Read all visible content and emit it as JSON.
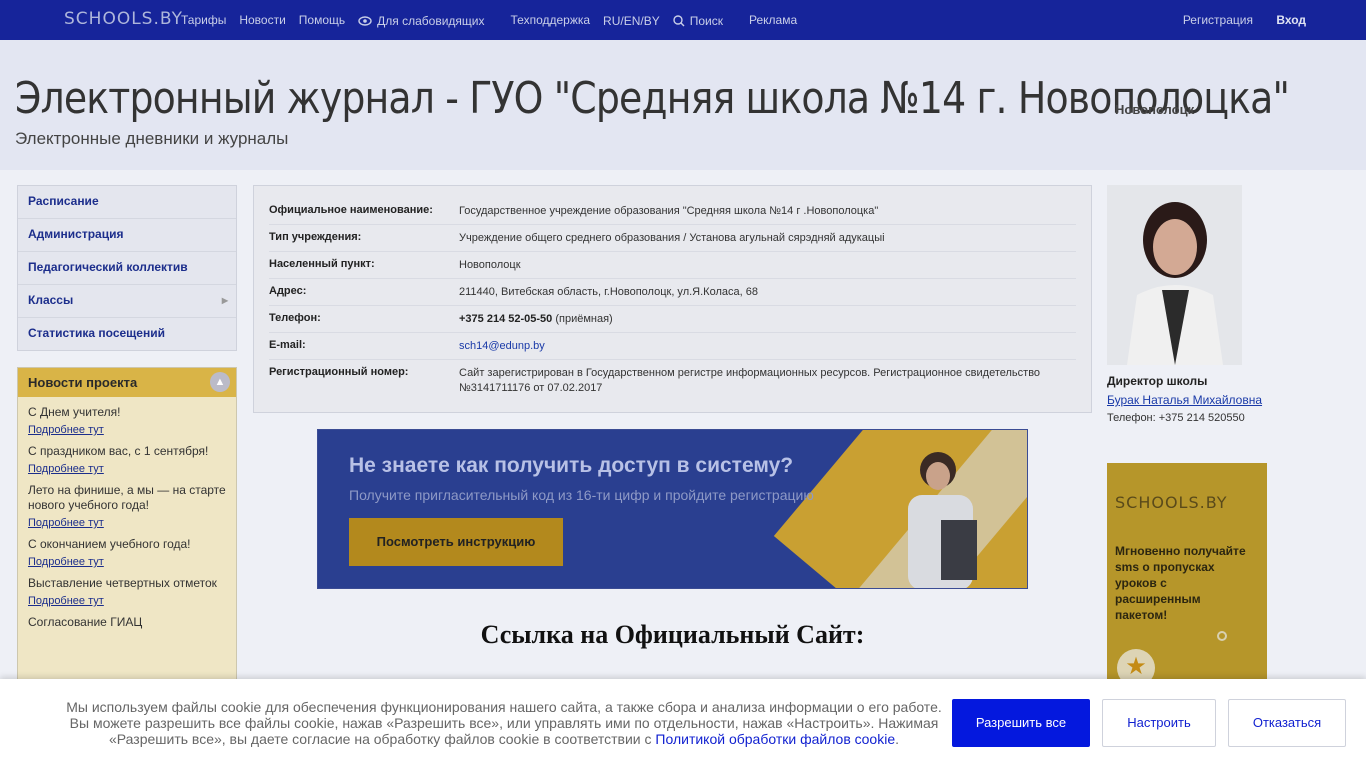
{
  "topbar": {
    "logo": "SCHOOLS.BY",
    "nav": [
      "Тарифы",
      "Новости",
      "Помощь",
      "Для слабовидящих",
      "Техподдержка",
      "RU/EN/BY",
      "Поиск",
      "Реклама"
    ],
    "register": "Регистрация",
    "login": "Вход"
  },
  "header": {
    "title": "Электронный журнал - ГУО \"Средняя школа №14 г. Новополоцка\"",
    "city": "Новополоцк",
    "subtitle": "Электронные дневники и журналы"
  },
  "sidebar": {
    "menu": [
      "Расписание",
      "Администрация",
      "Педагогический коллектив",
      "Классы",
      "Статистика посещений"
    ],
    "news_title": "Новости проекта",
    "news": [
      {
        "title": "С Днем учителя!",
        "more": "Подробнее тут"
      },
      {
        "title": "С праздником вас, с 1 сентября!",
        "more": "Подробнее тут"
      },
      {
        "title": "Лето на финише, а мы — на старте нового учебного года!",
        "more": "Подробнее тут"
      },
      {
        "title": "С окончанием учебного года!",
        "more": "Подробнее тут"
      },
      {
        "title": "Выставление четвертных отметок",
        "more": "Подробнее тут"
      },
      {
        "title": "Согласование ГИАЦ",
        "more": ""
      }
    ]
  },
  "info": {
    "rows": [
      {
        "label": "Официальное наименование:",
        "value": "Государственное учреждение образования \"Средняя школа №14 г .Новополоцка\""
      },
      {
        "label": "Тип учреждения:",
        "value": "Учреждение общего среднего образования / Установа агульнай сярэдняй адукацыі"
      },
      {
        "label": "Населенный пункт:",
        "value": "Новополоцк"
      },
      {
        "label": "Адрес:",
        "value": "211440, Витебская область, г.Новополоцк, ул.Я.Коласа, 68"
      },
      {
        "label": "Телефон:",
        "value_bold": "+375 214 52-05-50",
        "value": " (приёмная)"
      },
      {
        "label": "E-mail:",
        "link": "sch14@edunp.by"
      },
      {
        "label": "Регистрационный номер:",
        "value": "Сайт зарегистрирован в Государственном регистре информационных ресурсов. Регистрационное свидетельство №3141711176 от 07.02.2017"
      }
    ]
  },
  "banner": {
    "headline": "Не знаете как получить доступ в систему?",
    "subline": "Получите пригласительный код из 16-ти цифр и пройдите регистрацию",
    "button": "Посмотреть инструкцию"
  },
  "official_link_heading": "Ссылка на Официальный Сайт:",
  "director": {
    "role": "Директор школы",
    "name": "Бурак Наталья Михайловна",
    "phone": "Телефон: +375 214 520550"
  },
  "ad": {
    "logo": "SCHOOLS.BY",
    "text": "Мгновенно получайте sms о пропусках уроков с расширенным пакетом!"
  },
  "cookie": {
    "text": "Мы используем файлы cookie для обеспечения функционирования нашего сайта, а также сбора и анализа информации о его работе. Вы можете разрешить все файлы cookie, нажав «Разрешить все», или управлять ими по отдельности, нажав «Настроить». Нажимая «Разрешить все», вы даете согласие на обработку файлов cookie в соответствии с ",
    "policy_link": "Политикой обработки файлов cookie",
    "tail": ".",
    "allow": "Разрешить все",
    "configure": "Настроить",
    "decline": "Отказаться"
  },
  "colors": {
    "topbar": "#16249a",
    "accent_gold": "#d9b447",
    "allow_button": "#0418de"
  }
}
